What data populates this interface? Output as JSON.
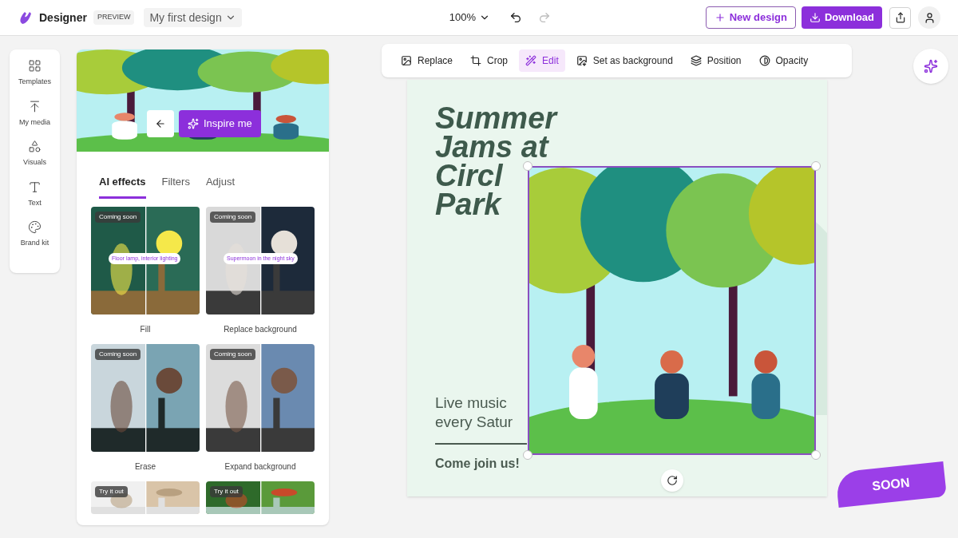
{
  "header": {
    "app_name": "Designer",
    "badge": "PREVIEW",
    "design_name": "My first design",
    "zoom": "100%",
    "redo_disabled": true,
    "buttons": [
      {
        "label": "New design",
        "kind": "outline"
      },
      {
        "label": "Download",
        "kind": "primary"
      }
    ]
  },
  "rail": [
    {
      "label": "Templates"
    },
    {
      "label": "My media"
    },
    {
      "label": "Visuals"
    },
    {
      "label": "Text"
    },
    {
      "label": "Brand kit"
    }
  ],
  "panel": {
    "inspire_button": "Inspire me",
    "tabs": [
      {
        "label": "AI effects",
        "selected": true
      },
      {
        "label": "Filters",
        "selected": false
      },
      {
        "label": "Adjust",
        "selected": false
      }
    ],
    "effects": [
      {
        "badge": "Coming soon",
        "prompt": "Floor lamp, interior lighting",
        "label": "Fill"
      },
      {
        "badge": "Coming soon",
        "prompt": "Supermoon in the night sky",
        "label": "Replace background"
      },
      {
        "badge": "Coming soon",
        "label": "Erase"
      },
      {
        "badge": "Coming soon",
        "label": "Expand background"
      },
      {
        "badge": "Try it out"
      },
      {
        "badge": "Try it out"
      }
    ]
  },
  "toolbar": [
    {
      "label": "Replace",
      "selected": false
    },
    {
      "label": "Crop",
      "selected": false
    },
    {
      "label": "Edit",
      "selected": true
    },
    {
      "label": "Set as background",
      "selected": false
    },
    {
      "label": "Position",
      "selected": false
    },
    {
      "label": "Opacity",
      "selected": false
    }
  ],
  "canvas": {
    "title_lines": [
      "Summer",
      "Jams at",
      "Circl",
      "Park"
    ],
    "subtitle_lines": [
      "Live music",
      "every Satur"
    ],
    "cta": "Come join us!",
    "sticker": "SOON"
  }
}
